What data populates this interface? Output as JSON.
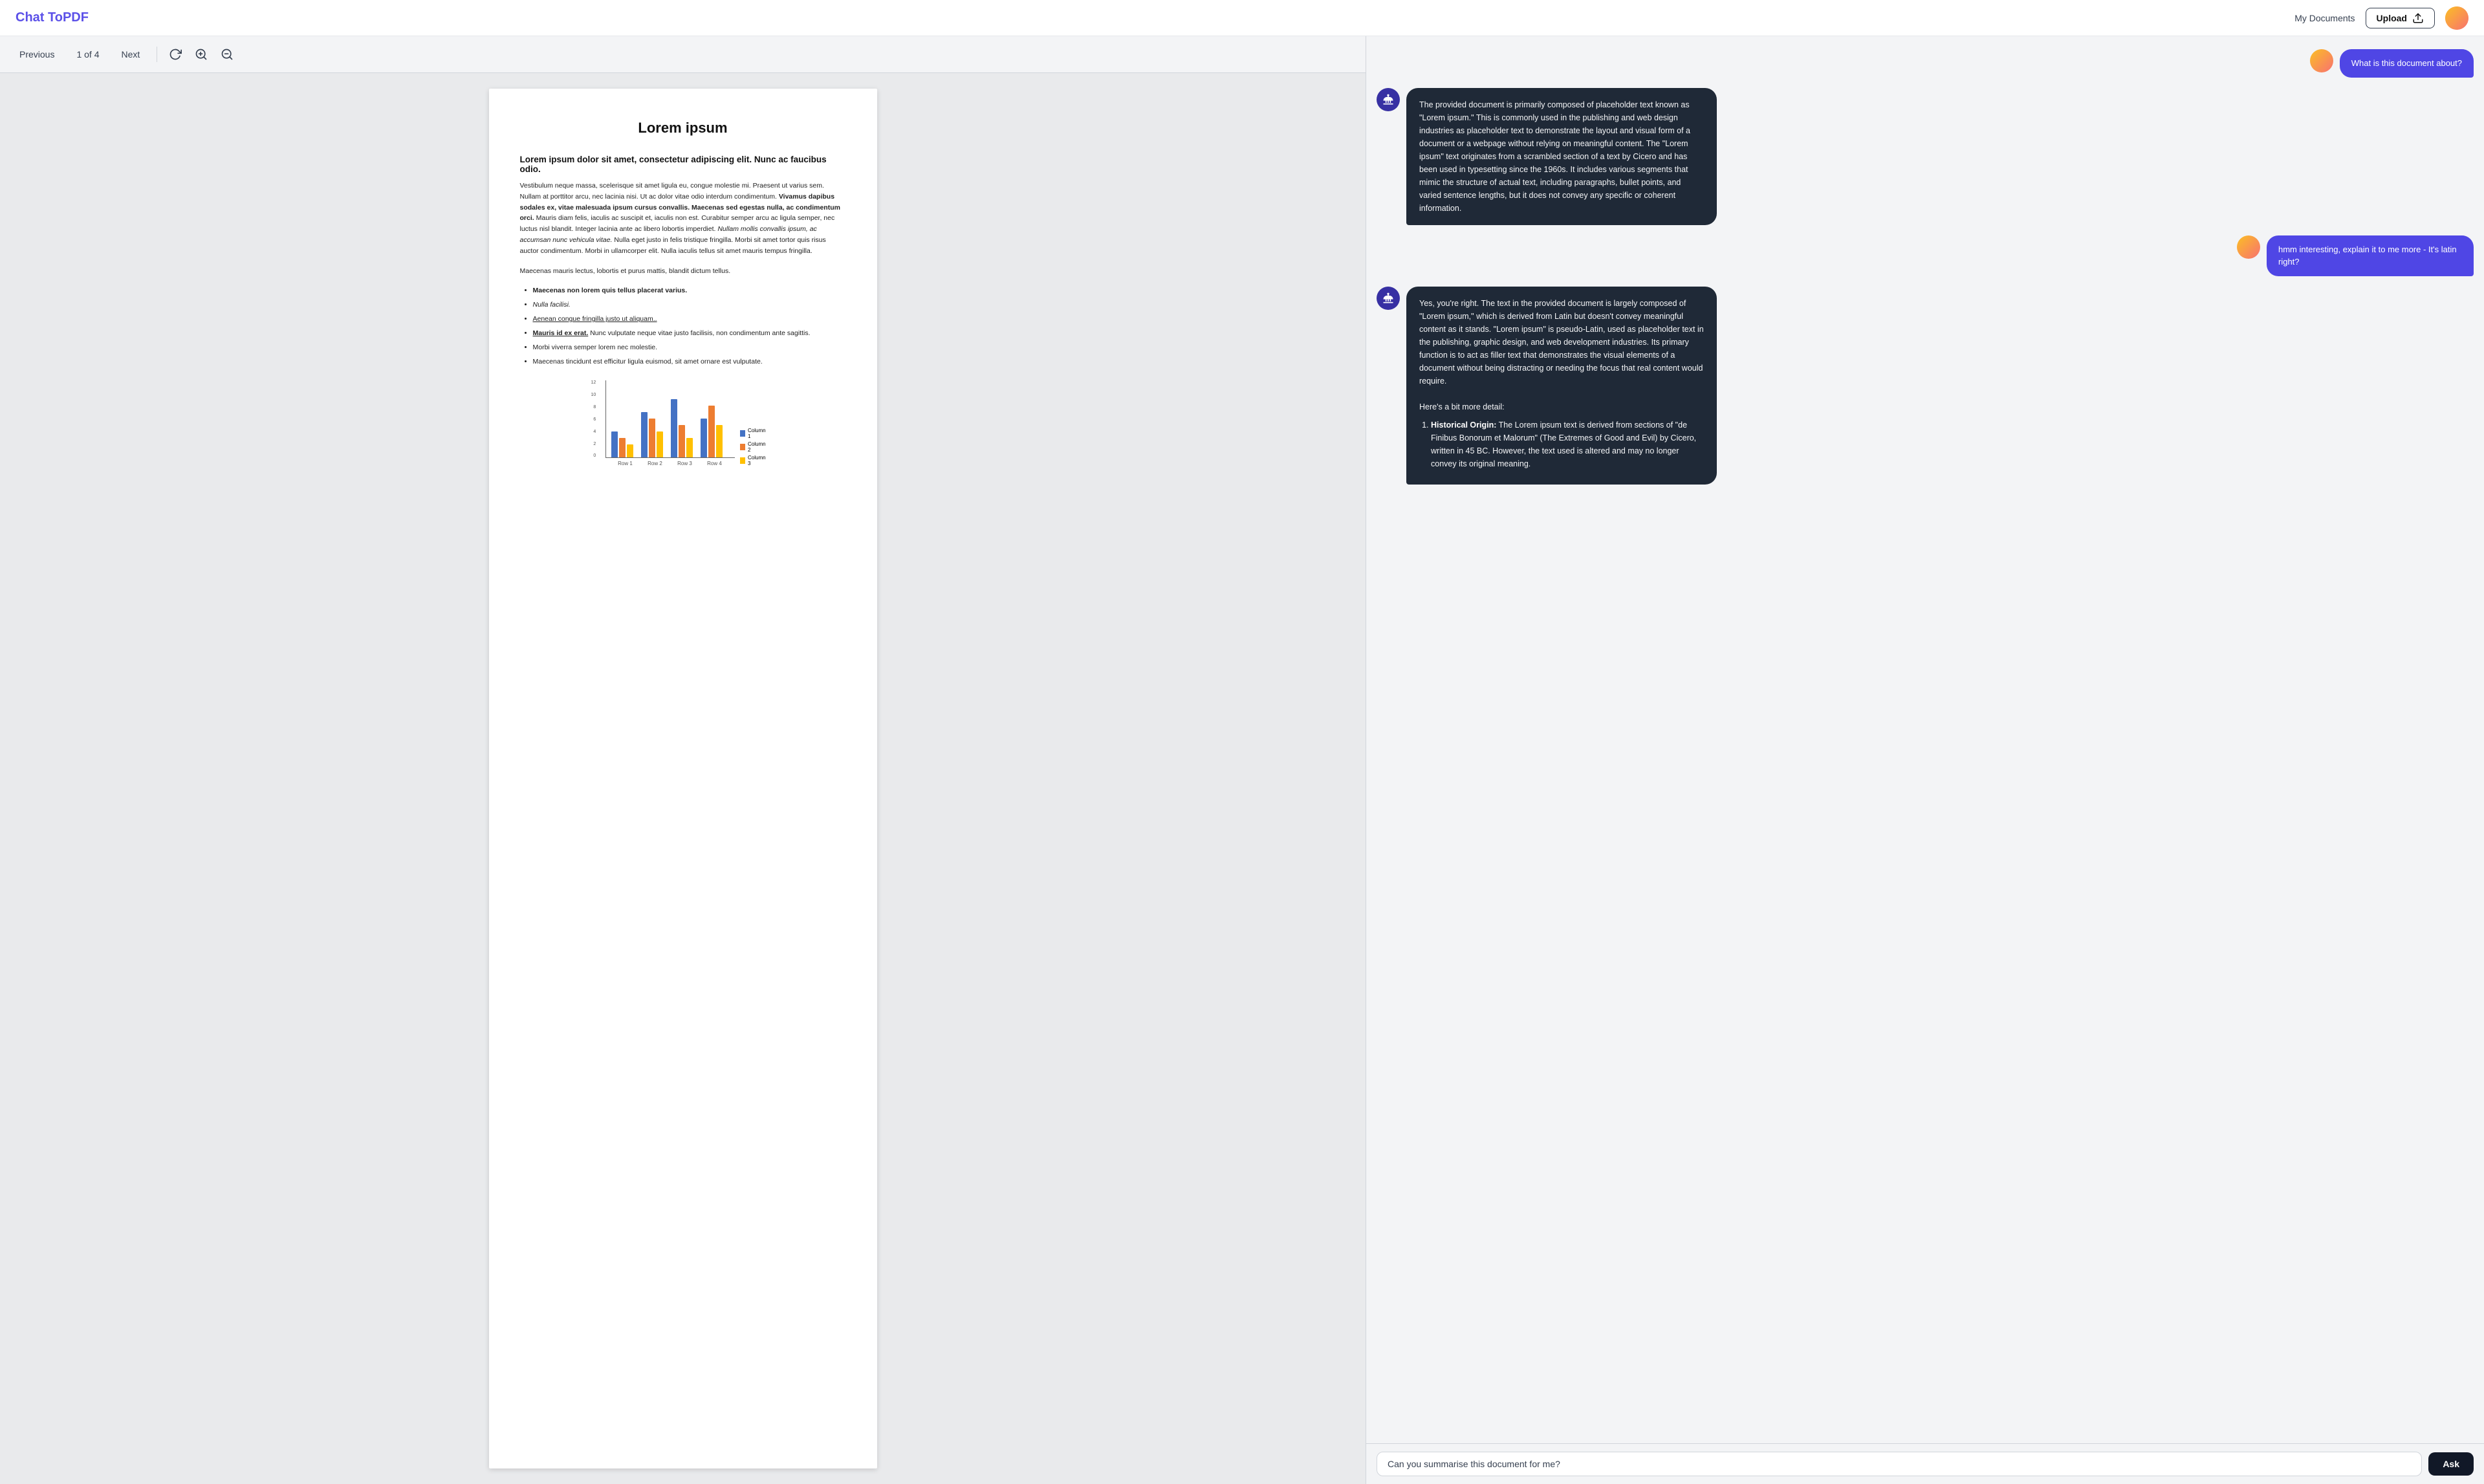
{
  "app": {
    "name": "Chat To",
    "name_accent": "PDF"
  },
  "header": {
    "my_documents_label": "My Documents",
    "upload_label": "Upload"
  },
  "toolbar": {
    "previous_label": "Previous",
    "page_indicator": "1 of 4",
    "next_label": "Next"
  },
  "pdf": {
    "title": "Lorem ipsum",
    "section_heading": "Lorem ipsum dolor sit amet, consectetur adipiscing elit. Nunc ac faucibus odio.",
    "paragraph1": "Vestibulum neque massa, scelerisque sit amet ligula eu, congue molestie mi. Praesent ut varius sem. Nullam at porttitor arcu, nec lacinia nisi. Ut ac dolor vitae odio interdum condimentum.",
    "paragraph1_bold": "Vivamus dapibus sodales ex, vitae malesuada ipsum cursus convallis. Maecenas sed egestas nulla, ac condimentum orci.",
    "paragraph1_cont": "Mauris diam felis, iaculis ac suscipit et, iaculis non est. Curabitur semper arcu ac ligula semper, nec luctus nisl blandit. Integer lacinia ante ac libero lobortis imperdiet.",
    "paragraph1_italic": "Nullam mollis convallis ipsum, ac accumsan nunc vehicula vitae.",
    "paragraph1_end": "Nulla eget justo in felis tristique fringilla. Morbi sit amet tortor quis risus auctor condimentum. Morbi in ullamcorper elit. Nulla iaculis tellus sit amet mauris tempus fringilla.",
    "paragraph2": "Maecenas mauris lectus, lobortis et purus mattis, blandit dictum tellus.",
    "list_items": [
      {
        "text": "Maecenas non lorem quis tellus placerat varius.",
        "bold": true,
        "underline": false
      },
      {
        "text": "Nulla facilisi.",
        "bold": false,
        "underline": false,
        "italic": true
      },
      {
        "text": "Aenean congue fringilla justo ut aliquam..",
        "bold": false,
        "underline": true
      },
      {
        "text": "Mauris id ex erat.",
        "bold": false,
        "underline": false,
        "extra": "Nunc vulputate neque vitae justo facilisis, non condimentum ante sagittis."
      },
      {
        "text": "Morbi viverra semper lorem nec molestie.",
        "bold": false,
        "underline": false
      },
      {
        "text": "Maecenas tincidunt est efficitur ligula euismod, sit amet ornare est vulputate.",
        "bold": false,
        "underline": false
      }
    ],
    "chart": {
      "y_labels": [
        "12",
        "10",
        "8",
        "6",
        "4",
        "2",
        "0"
      ],
      "x_labels": [
        "Row 1",
        "Row 2",
        "Row 3",
        "Row 4"
      ],
      "legend": [
        "Column 1",
        "Column 2",
        "Column 3"
      ],
      "colors": [
        "#4472c4",
        "#ed7d31",
        "#ffc000"
      ],
      "data": [
        [
          4,
          3,
          2
        ],
        [
          7,
          6,
          4
        ],
        [
          9,
          5,
          3
        ],
        [
          6,
          8,
          5
        ]
      ]
    }
  },
  "chat": {
    "messages": [
      {
        "role": "user",
        "text": "What is this document about?"
      },
      {
        "role": "bot",
        "text": "The provided document is primarily composed of placeholder text known as \"Lorem ipsum.\" This is commonly used in the publishing and web design industries as placeholder text to demonstrate the layout and visual form of a document or a webpage without relying on meaningful content. The \"Lorem ipsum\" text originates from a scrambled section of a text by Cicero and has been used in typesetting since the 1960s. It includes various segments that mimic the structure of actual text, including paragraphs, bullet points, and varied sentence lengths, but it does not convey any specific or coherent information."
      },
      {
        "role": "user",
        "text": "hmm interesting, explain it to me more - It's latin right?"
      },
      {
        "role": "bot",
        "text": "Yes, you're right. The text in the provided document is largely composed of \"Lorem ipsum,\" which is derived from Latin but doesn't convey meaningful content as it stands. \"Lorem ipsum\" is pseudo-Latin, used as placeholder text in the publishing, graphic design, and web development industries. Its primary function is to act as filler text that demonstrates the visual elements of a document without being distracting or needing the focus that real content would require.\n\nHere's a bit more detail:\n\n1. Historical Origin: The Lorem ipsum text is derived from sections of \"de Finibus Bonorum et Malorum\" (The Extremes of Good and Evil) by Cicero, written in 45 BC. However, the text used is altered and may no longer convey its original meaning."
      }
    ],
    "input_placeholder": "Can you summarise this document for me?",
    "input_value": "Can you summarise this document for me?",
    "ask_button_label": "Ask"
  }
}
